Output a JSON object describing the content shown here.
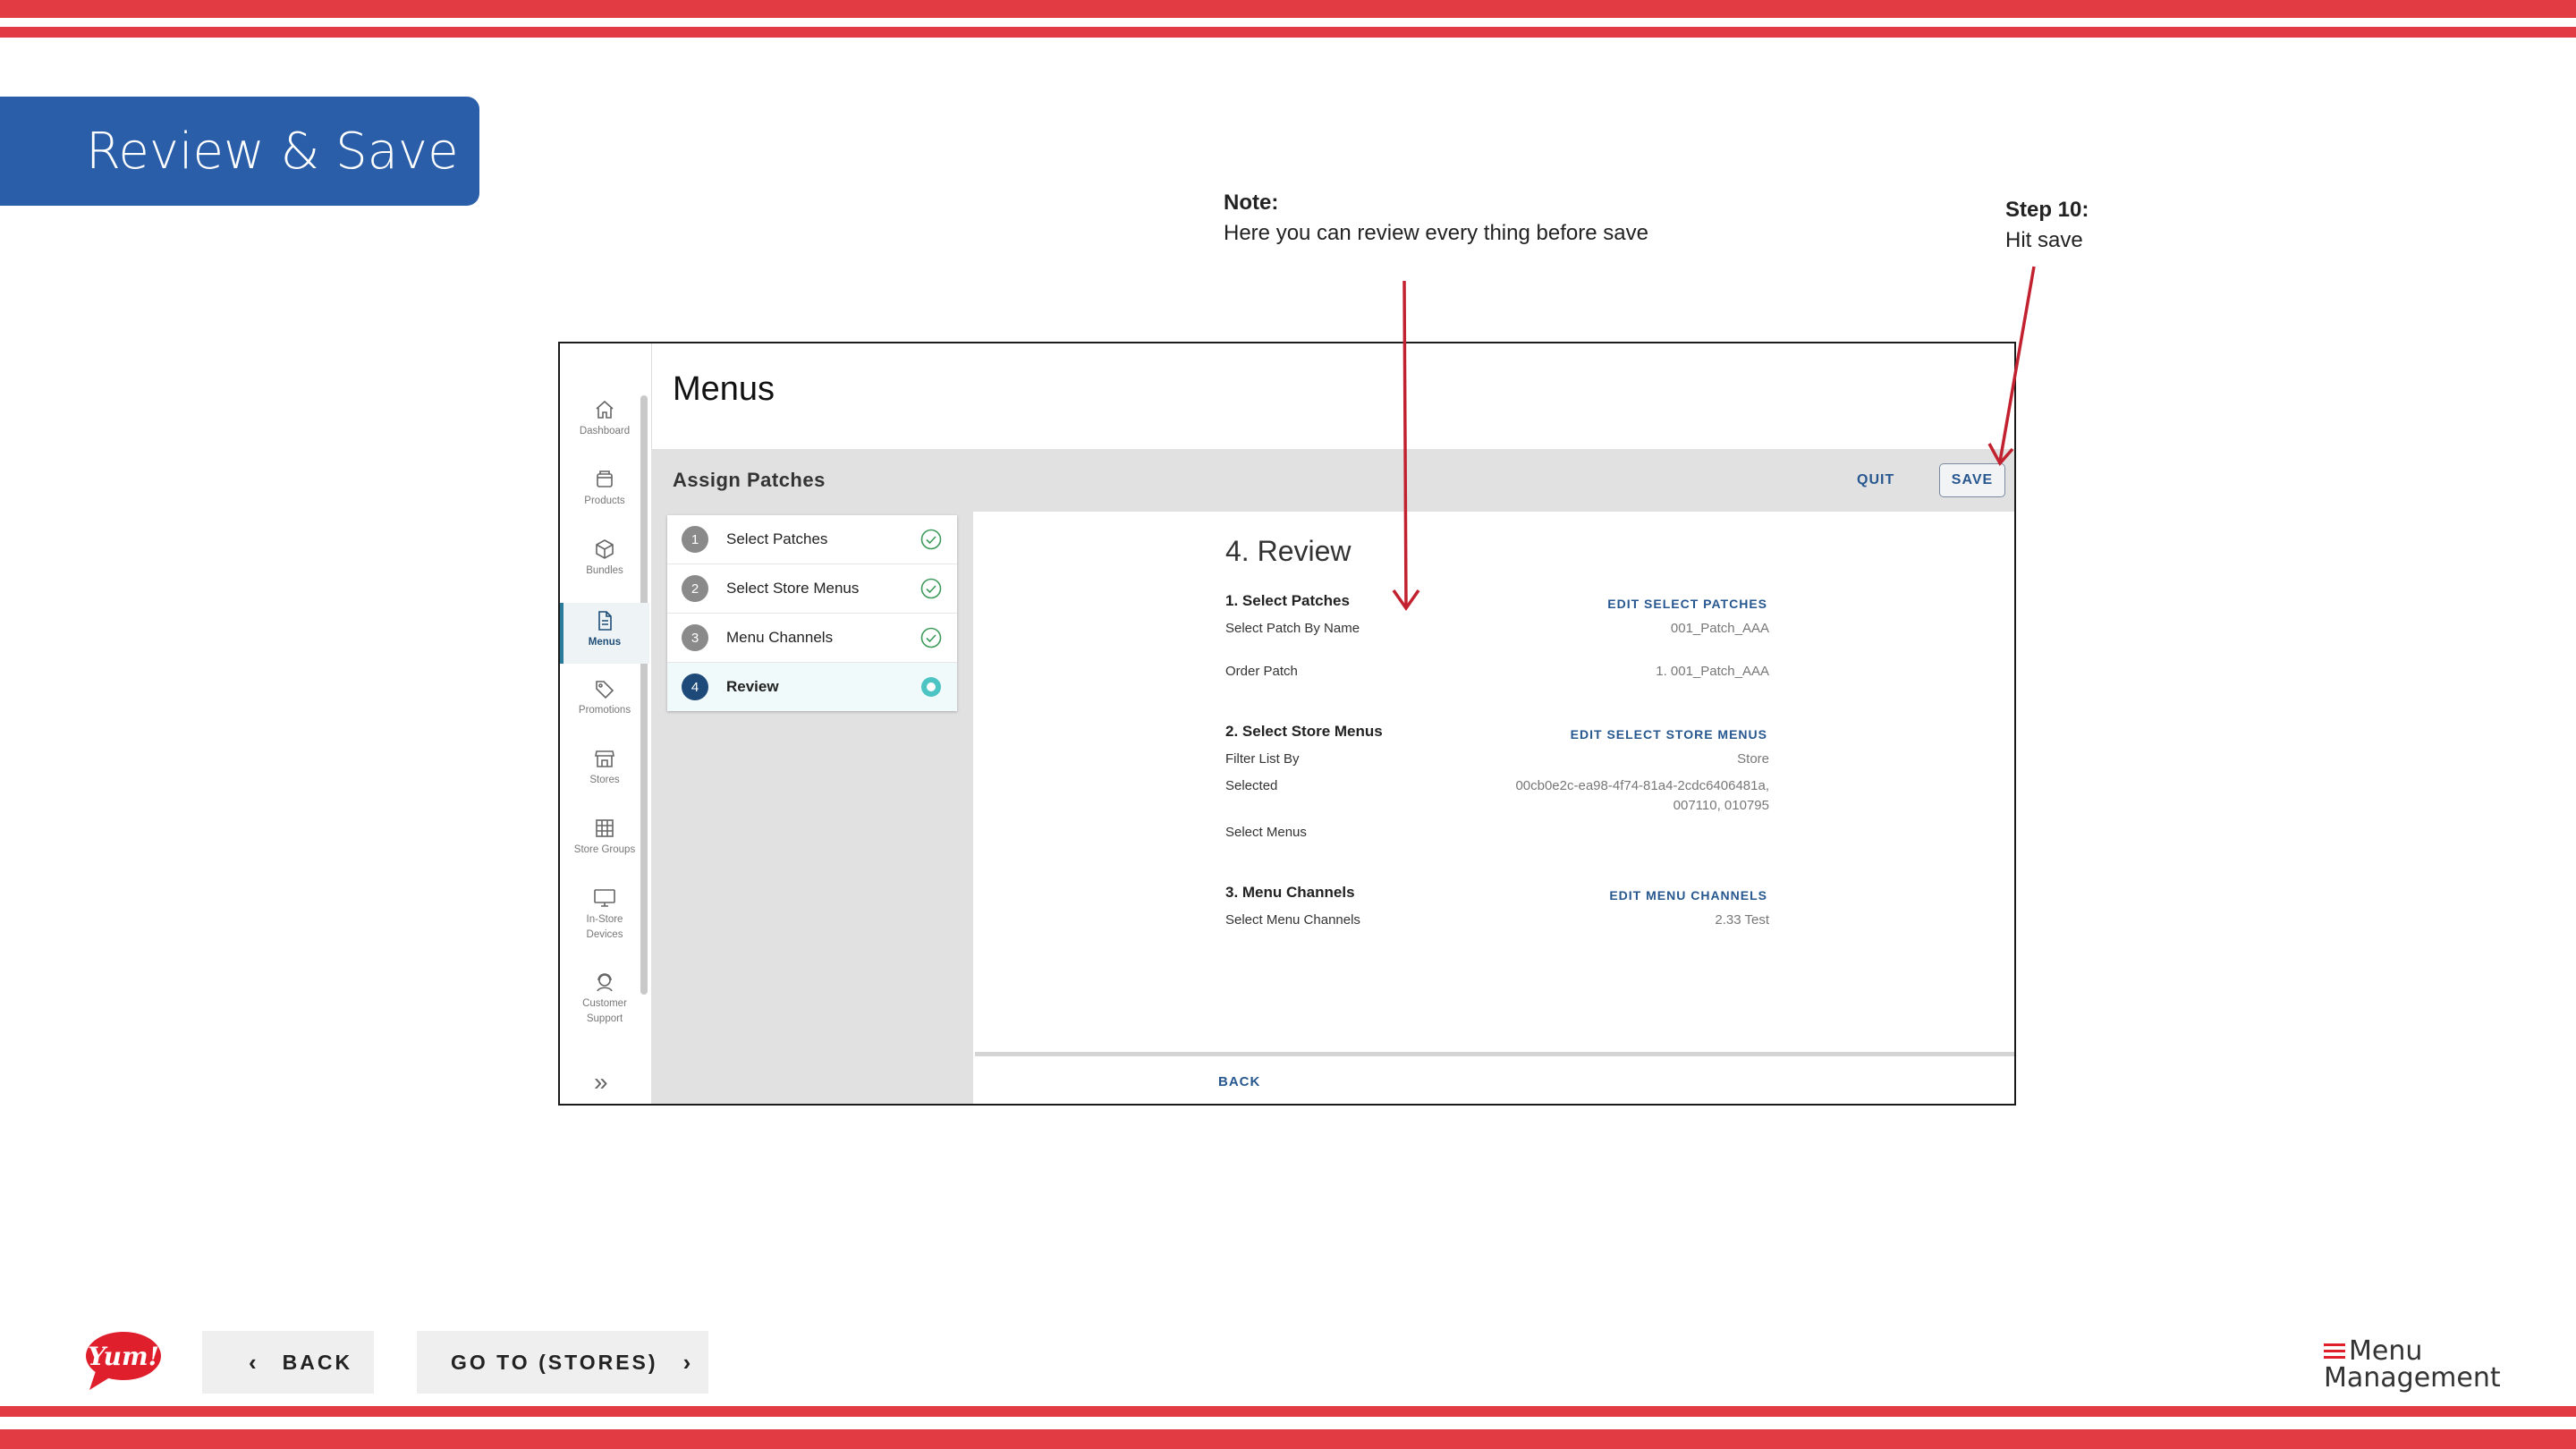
{
  "slide": {
    "title": "Review & Save",
    "note_heading": "Note:",
    "note_text": "Here you can review every thing before save",
    "step_heading": "Step 10:",
    "step_text": "Hit save",
    "colors": {
      "stripe": "#e23b44",
      "title_tab": "#2a5ea8",
      "link": "#27578f"
    }
  },
  "rail": {
    "items": [
      {
        "label": "Dashboard",
        "icon": "home-icon"
      },
      {
        "label": "Products",
        "icon": "box-icon"
      },
      {
        "label": "Bundles",
        "icon": "cube-icon"
      },
      {
        "label": "Menus",
        "icon": "document-icon",
        "active": true
      },
      {
        "label": "Promotions",
        "icon": "tag-icon"
      },
      {
        "label": "Stores",
        "icon": "store-icon"
      },
      {
        "label": "Store Groups",
        "icon": "grid-icon"
      },
      {
        "label": "In-Store Devices",
        "line1": "In-Store",
        "line2": "Devices",
        "icon": "monitor-icon"
      },
      {
        "label": "Customer Support",
        "line1": "Customer",
        "line2": "Support",
        "icon": "support-icon"
      }
    ],
    "expand_icon": "double-chevron-right-icon",
    "expand_glyph": "»"
  },
  "app": {
    "page_title": "Menus",
    "section_title": "Assign Patches",
    "quit_label": "QUIT",
    "save_label": "SAVE"
  },
  "stepper": {
    "steps": [
      {
        "num": "1",
        "label": "Select Patches",
        "status": "complete"
      },
      {
        "num": "2",
        "label": "Select Store Menus",
        "status": "complete"
      },
      {
        "num": "3",
        "label": "Menu Channels",
        "status": "complete"
      },
      {
        "num": "4",
        "label": "Review",
        "status": "current"
      }
    ]
  },
  "review": {
    "title": "4. Review",
    "sections": [
      {
        "heading": "1. Select Patches",
        "edit_label": "EDIT SELECT PATCHES",
        "rows": [
          {
            "label": "Select Patch By Name",
            "value": "001_Patch_AAA"
          },
          {
            "label": "Order Patch",
            "value": "1. 001_Patch_AAA"
          }
        ]
      },
      {
        "heading": "2. Select Store Menus",
        "edit_label": "EDIT SELECT STORE MENUS",
        "rows": [
          {
            "label": "Filter List By",
            "value": "Store"
          },
          {
            "label": "Selected",
            "value_line1": "00cb0e2c-ea98-4f74-81a4-2cdc6406481a,",
            "value_line2": "007110, 010795"
          },
          {
            "label": "Select Menus",
            "value": ""
          }
        ]
      },
      {
        "heading": "3. Menu Channels",
        "edit_label": "EDIT MENU CHANNELS",
        "rows": [
          {
            "label": "Select Menu Channels",
            "value": "2.33 Test"
          }
        ]
      }
    ],
    "back_label": "BACK"
  },
  "footer": {
    "back_label": "BACK",
    "goto_label": "GO TO (STORES)",
    "yum_logo_text": "Yum!",
    "product_logo_line1": "Menu",
    "product_logo_line2": "Management"
  }
}
